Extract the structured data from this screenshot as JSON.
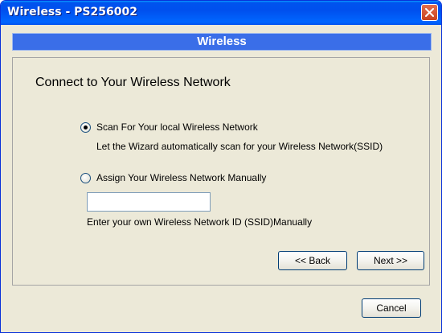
{
  "window": {
    "title": "Wireless - PS256002"
  },
  "banner": {
    "title": "Wireless"
  },
  "panel": {
    "heading": "Connect to Your Wireless Network",
    "option_scan": {
      "label": "Scan For Your local Wireless Network",
      "description": "Let the Wizard automatically scan for your Wireless Network(SSID)",
      "selected": true
    },
    "option_manual": {
      "label": "Assign Your Wireless Network Manually",
      "description": "Enter your own Wireless Network ID (SSID)Manually",
      "selected": false,
      "ssid_value": ""
    }
  },
  "buttons": {
    "back": "<< Back",
    "next": "Next >>",
    "cancel": "Cancel"
  },
  "icons": {
    "close": "close-icon"
  },
  "colors": {
    "titlebar": "#0054e3",
    "banner": "#3a6ee8",
    "close_button": "#d8582f",
    "dialog_bg": "#ece9d8"
  }
}
